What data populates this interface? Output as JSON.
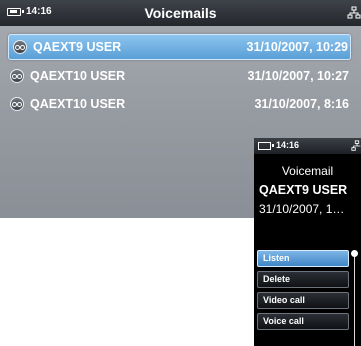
{
  "main": {
    "status": {
      "time": "14:16"
    },
    "title": "Voicemails",
    "items": [
      {
        "name": "QAEXT9 USER",
        "date": "31/10/2007, 10:29"
      },
      {
        "name": "QAEXT10 USER",
        "date": "31/10/2007, 10:27"
      },
      {
        "name": "QAEXT10 USER",
        "date": "31/10/2007, 8:16"
      }
    ],
    "icons": {
      "battery": "battery-icon",
      "network": "network-icon",
      "voicemail": "voicemail-icon"
    }
  },
  "detail": {
    "status": {
      "time": "14:16"
    },
    "title": "Voicemail",
    "name": "QAEXT9 USER",
    "date": "31/10/2007, 1…",
    "actions": [
      "Listen",
      "Delete",
      "Video call",
      "Voice call"
    ]
  },
  "colors": {
    "selection": "#5a9fd6",
    "topbar": "#23262b",
    "background": "#989ca3"
  }
}
